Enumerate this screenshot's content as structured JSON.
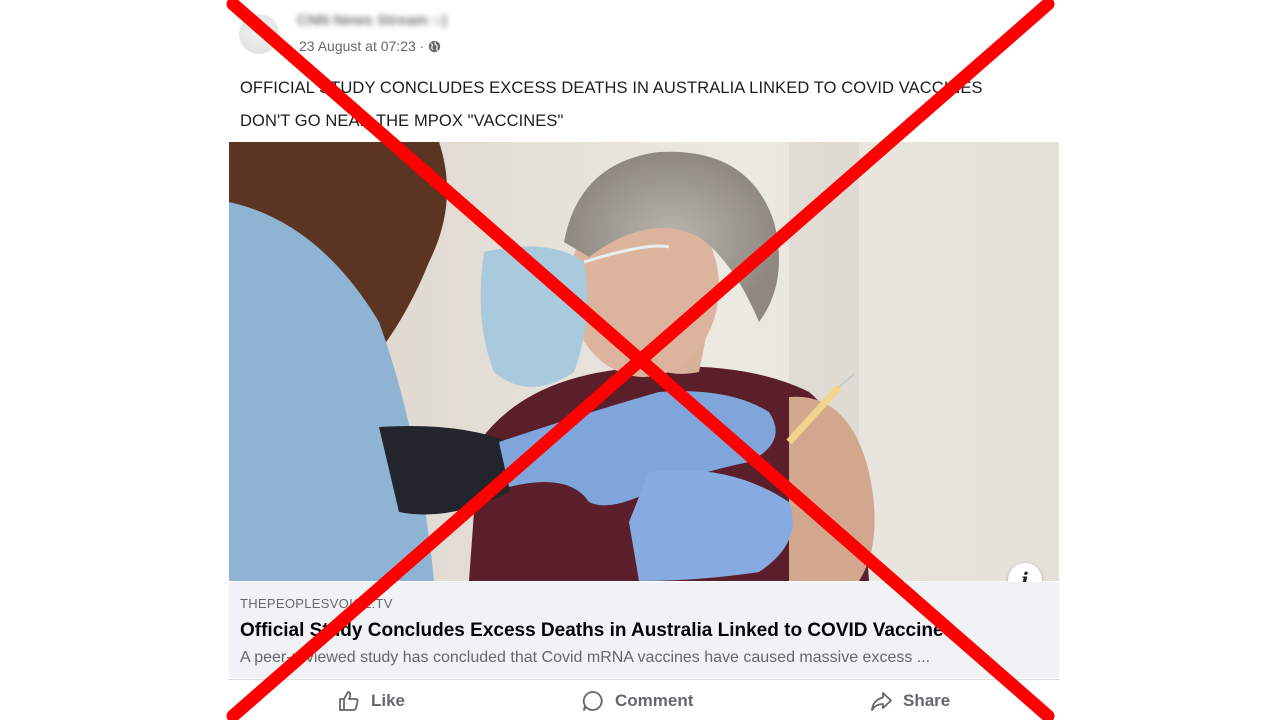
{
  "post": {
    "author": "CNN News Stream :-)",
    "timestamp": "23 August at 07:23 ·",
    "audience_icon": "globe-icon",
    "text_lines": [
      "OFFICIAL STUDY CONCLUDES EXCESS DEATHS IN AUSTRALIA LINKED TO COVID VACCINES",
      "DON'T GO NEAR THE MPOX \"VACCINES\""
    ]
  },
  "image": {
    "description_icon": "vaccination-photo"
  },
  "info_button": {
    "label": "i"
  },
  "link_preview": {
    "domain": "THEPEOPLESVOICE.TV",
    "title": "Official Study Concludes Excess Deaths in Australia Linked to COVID Vaccines",
    "description": "A peer-reviewed study has concluded that Covid mRNA vaccines have caused massive excess ..."
  },
  "actions": {
    "like": "Like",
    "comment": "Comment",
    "share": "Share"
  },
  "overlay": {
    "cross_color": "#ff0000"
  }
}
